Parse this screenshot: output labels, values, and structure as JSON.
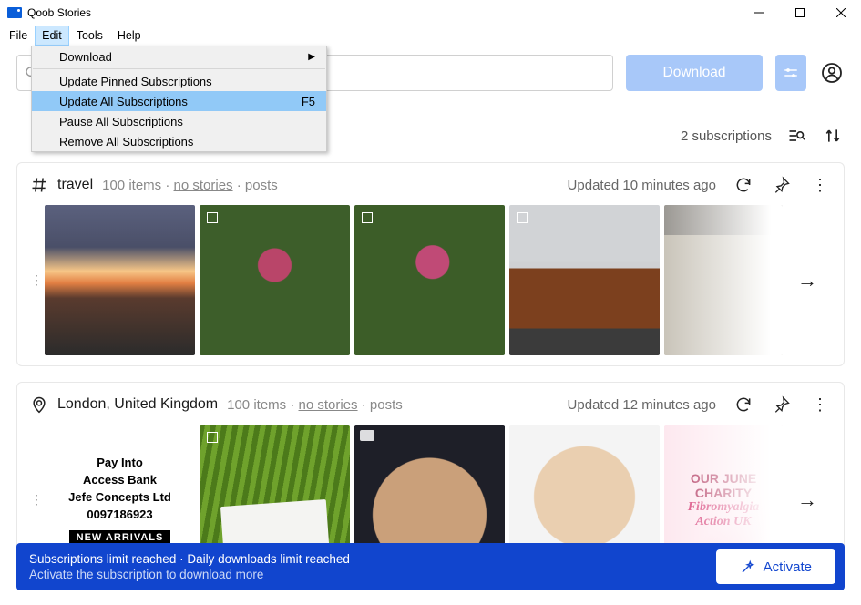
{
  "window": {
    "title": "Qoob Stories"
  },
  "menubar": {
    "file": "File",
    "edit": "Edit",
    "tools": "Tools",
    "help": "Help"
  },
  "edit_menu": {
    "download": "Download",
    "update_pinned": "Update Pinned Subscriptions",
    "update_all": "Update All Subscriptions",
    "update_all_shortcut": "F5",
    "pause_all": "Pause All Subscriptions",
    "remove_all": "Remove All Subscriptions"
  },
  "toolbar": {
    "download_label": "Download"
  },
  "subs_row": {
    "count_label": "2 subscriptions"
  },
  "cards": [
    {
      "icon": "hashtag",
      "name": "travel",
      "items": "100 items",
      "no_stories": "no stories",
      "posts": "posts",
      "updated": "Updated 10 minutes ago"
    },
    {
      "icon": "location",
      "name": "London, United Kingdom",
      "items": "100 items",
      "no_stories": "no stories",
      "posts": "posts",
      "updated": "Updated 12 minutes ago"
    }
  ],
  "thumb_text": {
    "pay_l1": "Pay Into",
    "pay_l2": "Access Bank",
    "pay_l3": "Jefe Concepts Ltd",
    "pay_l4": "0097186923",
    "pay_na": "NEW ARRIVALS",
    "charity_l1": "OUR JUNE",
    "charity_l2": "CHARITY",
    "charity_l3": "Fibromyalgia",
    "charity_l4": "Action UK"
  },
  "banner": {
    "line1": "Subscriptions limit reached · Daily downloads limit reached",
    "line2": "Activate the subscription to download more",
    "activate_label": "Activate"
  }
}
